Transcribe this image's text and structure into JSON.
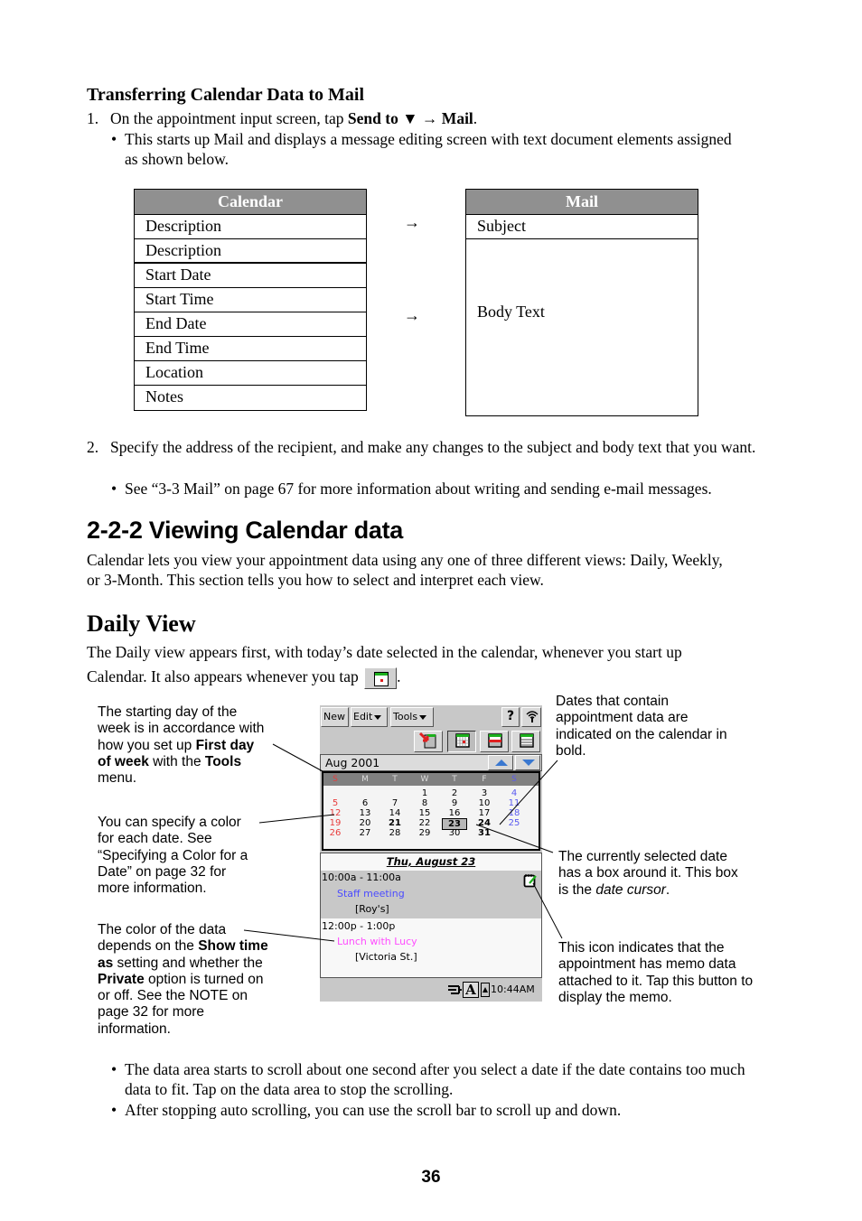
{
  "transfer": {
    "heading": "Transferring Calendar Data to Mail",
    "step1": {
      "number": "1.",
      "text_pre": "On the appointment input screen, tap ",
      "send_to": "Send to",
      "dropdown_glyph": "▼",
      "arrow": "→",
      "mail": "Mail",
      "end": ".",
      "bullet": "This starts up Mail and displays a message editing screen with text document elements assigned as shown below."
    },
    "calendar_table": {
      "header": "Calendar",
      "rows": [
        "Description",
        "Description",
        "Start Date",
        "Start Time",
        "End Date",
        "End Time",
        "Location",
        "Notes"
      ]
    },
    "arrows": [
      "→",
      "→"
    ],
    "mail_table": {
      "header": "Mail",
      "subject": "Subject",
      "body": "Body Text"
    },
    "step2": {
      "number": "2.",
      "text": "Specify the address of the recipient, and make any changes to the subject and body text that you want.",
      "bullet": "See “3-3 Mail” on page 67 for more information about writing and sending e-mail messages."
    }
  },
  "section": {
    "title": "2-2-2 Viewing Calendar data",
    "intro": "Calendar lets you view your appointment data using any one of three different views: Daily, Weekly, or 3-Month. This section tells you how to select and interpret each view."
  },
  "daily": {
    "title": "Daily View",
    "intro_line1": "The Daily view appears first, with today’s date selected in the calendar, whenever you start up",
    "intro_line2": "Calendar. It also appears whenever you tap",
    "intro_end": ".",
    "daily_button_icon": "daily-view-icon"
  },
  "device": {
    "menu": {
      "new": "New",
      "edit": "Edit",
      "tools": "Tools",
      "help": "?",
      "ir": "ir-icon"
    },
    "view_buttons": [
      "send-to-icon",
      "daily-view-icon",
      "weekly-view-icon",
      "month-view-icon"
    ],
    "month_label": "Aug 2001",
    "weekdays": [
      "S",
      "M",
      "T",
      "W",
      "T",
      "F",
      "S"
    ],
    "weeks": [
      [
        "",
        "",
        "",
        "1",
        "2",
        "3",
        "4"
      ],
      [
        "5",
        "6",
        "7",
        "8",
        "9",
        "10",
        "11"
      ],
      [
        "12",
        "13",
        "14",
        "15",
        "16",
        "17",
        "18"
      ],
      [
        "19",
        "20",
        "21",
        "22",
        "23",
        "24",
        "25"
      ],
      [
        "26",
        "27",
        "28",
        "29",
        "30",
        "31",
        ""
      ]
    ],
    "bold_dates": [
      "21",
      "23",
      "24",
      "31"
    ],
    "selected_date": "23",
    "colors": {
      "sunday": "#e83c3c",
      "saturday": "#5a5aef",
      "blue_text": "#4b4bff",
      "pink_text": "#ff4cff",
      "cursor_bg": "#b8b8b8",
      "header_bg": "#808080"
    },
    "date_header": "Thu, August 23",
    "appointments": [
      {
        "time": "10:00a - 11:00a",
        "title": "Staff meeting",
        "location": "[Roy's]",
        "has_memo": true
      },
      {
        "time": "12:00p - 1:00p",
        "title": "Lunch with Lucy",
        "location": "[Victoria St.]",
        "has_memo": false
      }
    ],
    "status": {
      "input": "A",
      "clock": "10:44AM"
    }
  },
  "callouts": {
    "first_day": [
      "The starting day of the",
      "week is in accordance with",
      "how you set up |First day|",
      "|of week| with the |Tools|",
      "menu."
    ],
    "color_date": [
      "You can specify a color",
      "for each date. See",
      "“Specifying a Color for a",
      "Date” on page 32 for",
      "more information."
    ],
    "data_color": [
      "The color of the data",
      "depends on the |Show time|",
      "|as| setting and whether the",
      "|Private| option is turned on",
      "or off. See the NOTE on",
      "page 32 for more",
      "information."
    ],
    "bold_dates": [
      "Dates that contain",
      "appointment data are",
      "indicated on the calendar in",
      "bold."
    ],
    "date_cursor": [
      "The currently selected date",
      "has a box around it. This box",
      "is the ~date cursor~."
    ],
    "memo_icon": [
      "This icon indicates that the",
      "appointment has memo data",
      "attached to it. Tap this button to",
      "display the memo."
    ]
  },
  "notes": [
    "The data area starts to scroll about one second after you select a date if the date contains too much data to fit. Tap on the data area to stop the scrolling.",
    "After stopping auto scrolling, you can use the scroll bar to scroll up and down."
  ],
  "page_number": "36"
}
